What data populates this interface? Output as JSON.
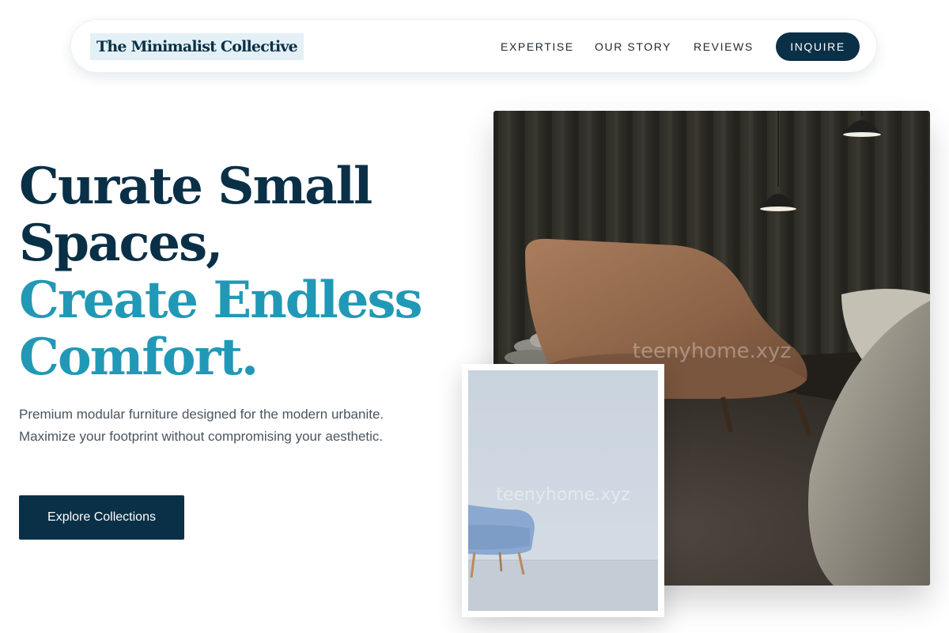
{
  "brand": {
    "name": "The Minimalist Collective"
  },
  "nav": {
    "links": [
      "EXPERTISE",
      "OUR STORY",
      "REVIEWS"
    ],
    "cta_label": "INQUIRE"
  },
  "hero": {
    "headline_line1": "Curate Small",
    "headline_line2": "Spaces,",
    "headline_line3": "Create Endless",
    "headline_line4": "Comfort.",
    "subtext": "Premium modular furniture designed for the modern urbanite. Maximize your footprint without compromising your aesthetic.",
    "cta_label": "Explore Collections"
  },
  "images": {
    "main_watermark": "teenyhome.xyz",
    "secondary_watermark": "teenyhome.xyz"
  },
  "colors": {
    "primary": "#0a3047",
    "accent": "#2199b6",
    "logo_bg": "#e3f1f6",
    "body_text": "#4a5560"
  }
}
